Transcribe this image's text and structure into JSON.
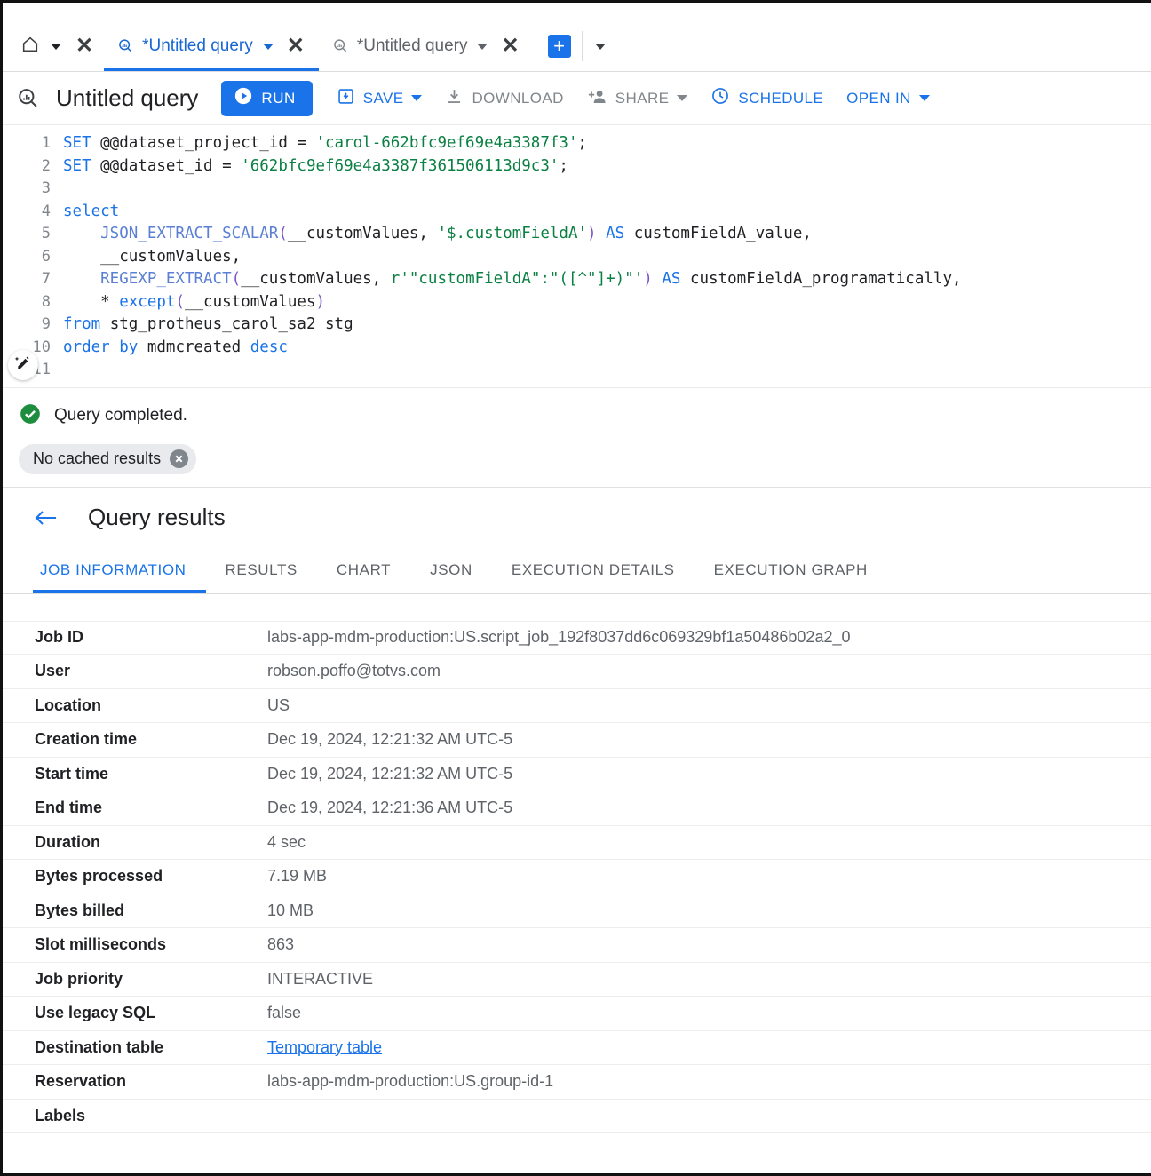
{
  "tabstrip": {
    "home_icon": "home-icon",
    "tabs": [
      {
        "label": "*Untitled query",
        "icon": "query-icon",
        "active": true
      },
      {
        "label": "*Untitled query",
        "icon": "query-icon",
        "active": false
      }
    ],
    "new_tab_label": "+",
    "close_label": "✕"
  },
  "toolbar": {
    "title": "Untitled query",
    "run_label": "RUN",
    "save_label": "SAVE",
    "download_label": "DOWNLOAD",
    "share_label": "SHARE",
    "schedule_label": "SCHEDULE",
    "open_in_label": "OPEN IN",
    "accent": "#1a73e8",
    "disabled_color": "#80868b"
  },
  "editor": {
    "lines": [
      "1",
      "2",
      "3",
      "4",
      "5",
      "6",
      "7",
      "8",
      "9",
      "10",
      "11"
    ],
    "code": {
      "l1_kw": "SET",
      "l1_var": " @@dataset_project_id = ",
      "l1_str": "'carol-662bfc9ef69e4a3387f3'",
      "l1_end": ";",
      "l2_kw": "SET",
      "l2_var": " @@dataset_id = ",
      "l2_str": "'662bfc9ef69e4a3387f361506113d9c3'",
      "l2_end": ";",
      "l4_kw": "select",
      "l5_fn": "    JSON_EXTRACT_SCALAR",
      "l5_p1": "(",
      "l5_arg": "__customValues, ",
      "l5_str": "'$.customFieldA'",
      "l5_p2": ")",
      "l5_as": " AS ",
      "l5_alias": "customFieldA_value,",
      "l6_text": "    __customValues,",
      "l7_fn": "    REGEXP_EXTRACT",
      "l7_p1": "(",
      "l7_arg": "__customValues, ",
      "l7_str": "r'\"customFieldA\":\"([^\"]+)\"'",
      "l7_p2": ")",
      "l7_as": " AS ",
      "l7_alias": "customFieldA_programatically,",
      "l8_star": "    * ",
      "l8_kw": "except",
      "l8_p1": "(",
      "l8_arg": "__customValues",
      "l8_p2": ")",
      "l9_kw": "from",
      "l9_text": " stg_protheus_carol_sa2 stg",
      "l10_kw": "order",
      "l10_by": " by ",
      "l10_col": "mdmcreated ",
      "l10_desc": "desc"
    },
    "ai_icon": "ai-pencil-icon"
  },
  "status": {
    "message": "Query completed.",
    "status_icon": "check-circle-icon",
    "chip_label": "No cached results",
    "chip_close": "✕",
    "success_color": "#1e8e3e"
  },
  "results": {
    "back_icon": "back-arrow-icon",
    "title": "Query results",
    "tabs": [
      {
        "label": "JOB INFORMATION",
        "active": true
      },
      {
        "label": "RESULTS",
        "active": false
      },
      {
        "label": "CHART",
        "active": false
      },
      {
        "label": "JSON",
        "active": false
      },
      {
        "label": "EXECUTION DETAILS",
        "active": false
      },
      {
        "label": "EXECUTION GRAPH",
        "active": false
      }
    ],
    "info_rows": [
      {
        "key": "Job ID",
        "value": "labs-app-mdm-production:US.script_job_192f8037dd6c069329bf1a50486b02a2_0",
        "link": false
      },
      {
        "key": "User",
        "value": "robson.poffo@totvs.com",
        "link": false
      },
      {
        "key": "Location",
        "value": "US",
        "link": false
      },
      {
        "key": "Creation time",
        "value": "Dec 19, 2024, 12:21:32 AM UTC-5",
        "link": false
      },
      {
        "key": "Start time",
        "value": "Dec 19, 2024, 12:21:32 AM UTC-5",
        "link": false
      },
      {
        "key": "End time",
        "value": "Dec 19, 2024, 12:21:36 AM UTC-5",
        "link": false
      },
      {
        "key": "Duration",
        "value": "4 sec",
        "link": false
      },
      {
        "key": "Bytes processed",
        "value": "7.19 MB",
        "link": false
      },
      {
        "key": "Bytes billed",
        "value": "10 MB",
        "link": false
      },
      {
        "key": "Slot milliseconds",
        "value": "863",
        "link": false
      },
      {
        "key": "Job priority",
        "value": "INTERACTIVE",
        "link": false
      },
      {
        "key": "Use legacy SQL",
        "value": "false",
        "link": false
      },
      {
        "key": "Destination table",
        "value": "Temporary table",
        "link": true
      },
      {
        "key": "Reservation",
        "value": "labs-app-mdm-production:US.group-id-1",
        "link": false
      },
      {
        "key": "Labels",
        "value": "",
        "link": false
      }
    ]
  }
}
